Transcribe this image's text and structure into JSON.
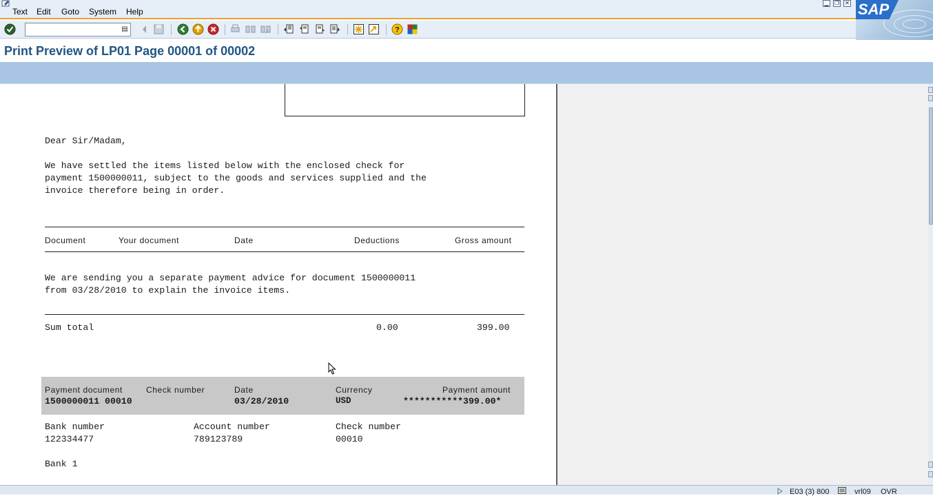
{
  "menu": {
    "items": [
      "Text",
      "Edit",
      "Goto",
      "System",
      "Help"
    ]
  },
  "window_controls": [
    "minimize",
    "restore",
    "close"
  ],
  "logo": {
    "text": "SAP"
  },
  "toolbar": {
    "command_field_value": "",
    "icons": [
      "enter-icon",
      "back-icon",
      "exit-icon",
      "cancel-icon",
      "print-icon",
      "find-icon",
      "find-next-icon",
      "first-page-icon",
      "previous-page-icon",
      "next-page-icon",
      "last-page-icon",
      "create-session-icon",
      "shortcut-icon",
      "help-icon",
      "customize-layout-icon"
    ]
  },
  "title": "Print Preview of LP01 Page 00001 of 00002",
  "document": {
    "salutation": "Dear Sir/Madam,",
    "intro_lines": [
      "We have settled the items listed below with the enclosed check for",
      "payment 1500000011, subject to the goods and services supplied and the",
      "invoice therefore being in order."
    ],
    "columns": {
      "document": "Document",
      "your_document": "Your document",
      "date": "Date",
      "deductions": "Deductions",
      "gross_amount": "Gross amount"
    },
    "advice_lines": [
      "We are sending you a separate payment advice for document 1500000011",
      "from 03/28/2010 to explain the invoice items."
    ],
    "sum_total": {
      "label": "Sum total",
      "deductions": "0.00",
      "gross": "399.00"
    },
    "payment": {
      "headers": {
        "payment_document": "Payment document",
        "check_number": "Check number",
        "date": "Date",
        "currency": "Currency",
        "payment_amount": "Payment amount"
      },
      "values": {
        "doc_and_check": "1500000011 00010",
        "date": "03/28/2010",
        "currency": "USD",
        "amount": "***********399.00*"
      }
    },
    "bank": {
      "bank_number_label": "Bank number",
      "bank_number": "122334477",
      "account_number_label": "Account number",
      "account_number": "789123789",
      "check_number_label": "Check number",
      "check_number": "00010",
      "bank_name": "Bank 1"
    }
  },
  "status": {
    "system": "E03 (3) 800",
    "server": "vrl09",
    "mode": "OVR"
  }
}
